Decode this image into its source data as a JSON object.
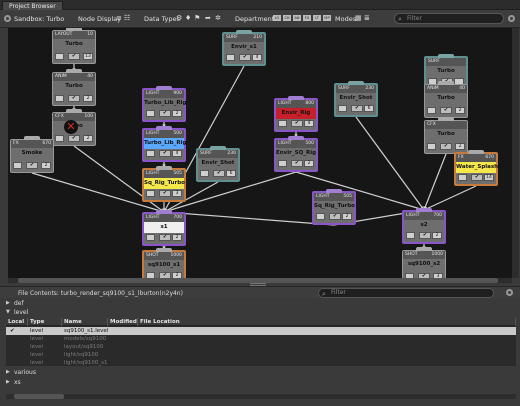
{
  "window": {
    "tab": "Project Browser"
  },
  "toolbar": {
    "sandbox": "Sandbox: Turbo",
    "node_display": "Node Display",
    "data_types": "Data Types",
    "data_type_icons": [
      "gear-icon",
      "pin-icon",
      "flag-icon",
      "share-icon",
      "sparkle-icon"
    ],
    "departments": "Departments",
    "department_codes": [
      "LO",
      "CH",
      "AN",
      "FX",
      "LT",
      "MP"
    ],
    "modes": "Modes",
    "filter_placeholder": "Filter"
  },
  "nodes": [
    {
      "id": "layout-turbo",
      "type": "LAYOUT",
      "ver": "10",
      "name": "Turbo",
      "count": "13",
      "style": "gray",
      "highlight": ""
    },
    {
      "id": "anim-turbo",
      "type": "ANIM",
      "ver": "40",
      "name": "Turbo",
      "count": "2",
      "style": "gray",
      "highlight": ""
    },
    {
      "id": "cfx-turbo",
      "type": "CFX",
      "ver": "100",
      "name": "Turbo",
      "count": "2",
      "style": "gray",
      "highlight": "red-x"
    },
    {
      "id": "fx-smoke",
      "type": "FX",
      "ver": "670",
      "name": "Smoke",
      "count": "2",
      "style": "gray",
      "highlight": ""
    },
    {
      "id": "light-turbo-lib-rig-900",
      "type": "LIGHT",
      "ver": "900",
      "name": "Turbo_Lib_Rig",
      "count": "2",
      "style": "purple",
      "highlight": ""
    },
    {
      "id": "light-turbo-lib-rig-500",
      "type": "LIGHT",
      "ver": "500",
      "name": "Turbo_Lib_Rig",
      "count": "4",
      "style": "purple",
      "highlight": "blue"
    },
    {
      "id": "light-sq-rig-turbo",
      "type": "LIGHT",
      "ver": "505",
      "name": "Sq_Rig_Turbo",
      "count": "3",
      "style": "orange",
      "highlight": "yellow"
    },
    {
      "id": "light-s1",
      "type": "LIGHT",
      "ver": "700",
      "name": "s1",
      "count": "2",
      "style": "purple",
      "highlight": "white"
    },
    {
      "id": "shot-sq9100-s1",
      "type": "SHOT",
      "ver": "1000",
      "name": "sq9100_s1",
      "count": "2",
      "style": "orange",
      "highlight": ""
    },
    {
      "id": "surf-envir-s1",
      "type": "SURF",
      "ver": "210",
      "name": "Envir_s1",
      "count": "4",
      "style": "teal",
      "highlight": ""
    },
    {
      "id": "surf-envir-shot-a",
      "type": "SURF",
      "ver": "230",
      "name": "Envir_Shot",
      "count": "6",
      "style": "teal",
      "highlight": ""
    },
    {
      "id": "light-envir-rig",
      "type": "LIGHT",
      "ver": "800",
      "name": "Envir_Rig",
      "count": "4",
      "style": "purple",
      "highlight": "red"
    },
    {
      "id": "light-envir-sq-rig",
      "type": "LIGHT",
      "ver": "500",
      "name": "Envir_SQ_Rig",
      "count": "2",
      "style": "purple",
      "highlight": ""
    },
    {
      "id": "surf-envir-shot-b",
      "type": "SURF",
      "ver": "230",
      "name": "Envir_Shot",
      "count": "6",
      "style": "teal",
      "highlight": ""
    },
    {
      "id": "light-sq-rig-turbo-2",
      "type": "LIGHT",
      "ver": "505",
      "name": "Sq_Rig_Turbo",
      "count": "2",
      "style": "purple",
      "highlight": ""
    },
    {
      "id": "surf-turbo",
      "type": "SURF",
      "ver": "",
      "name": "Turbo",
      "count": "",
      "style": "teal",
      "highlight": ""
    },
    {
      "id": "anim-turbo-2",
      "type": "ANIM",
      "ver": "40",
      "name": "Turbo",
      "count": "2",
      "style": "gray",
      "highlight": ""
    },
    {
      "id": "cfx-turbo-2",
      "type": "CFX",
      "ver": "",
      "name": "Turbo",
      "count": "2",
      "style": "gray",
      "highlight": ""
    },
    {
      "id": "fx-water-splash",
      "type": "FX",
      "ver": "670",
      "name": "Water_Splash",
      "count": "14",
      "style": "orange",
      "highlight": "yellow"
    },
    {
      "id": "light-s2",
      "type": "LIGHT",
      "ver": "700",
      "name": "s2",
      "count": "2",
      "style": "purple",
      "highlight": ""
    },
    {
      "id": "shot-sq9100-s2",
      "type": "SHOT",
      "ver": "1000",
      "name": "sq9100_s2",
      "count": "3",
      "style": "gray",
      "highlight": ""
    }
  ],
  "file_contents": {
    "label": "File Contents:  turbo_render_sq9100_s1_lburton(n2y4n)",
    "filter_placeholder": "Filter"
  },
  "sections": [
    {
      "label": "def"
    },
    {
      "label": "level"
    },
    {
      "label": "various"
    },
    {
      "label": "xs"
    }
  ],
  "table": {
    "columns": [
      "Local",
      "Type",
      "Name",
      "Modified",
      "File Location"
    ],
    "rows": [
      {
        "local": "✔",
        "type": "level",
        "name": "sq9100_s1.level",
        "modified": "",
        "location": ""
      },
      {
        "local": "",
        "type": "level",
        "name": "models/sq9100",
        "modified": "",
        "location": ""
      },
      {
        "local": "",
        "type": "level",
        "name": "layout/sq9100",
        "modified": "",
        "location": ""
      },
      {
        "local": "",
        "type": "level",
        "name": "light/sq9100",
        "modified": "",
        "location": ""
      },
      {
        "local": "",
        "type": "level",
        "name": "light/sq9100_s1",
        "modified": "",
        "location": ""
      }
    ]
  }
}
